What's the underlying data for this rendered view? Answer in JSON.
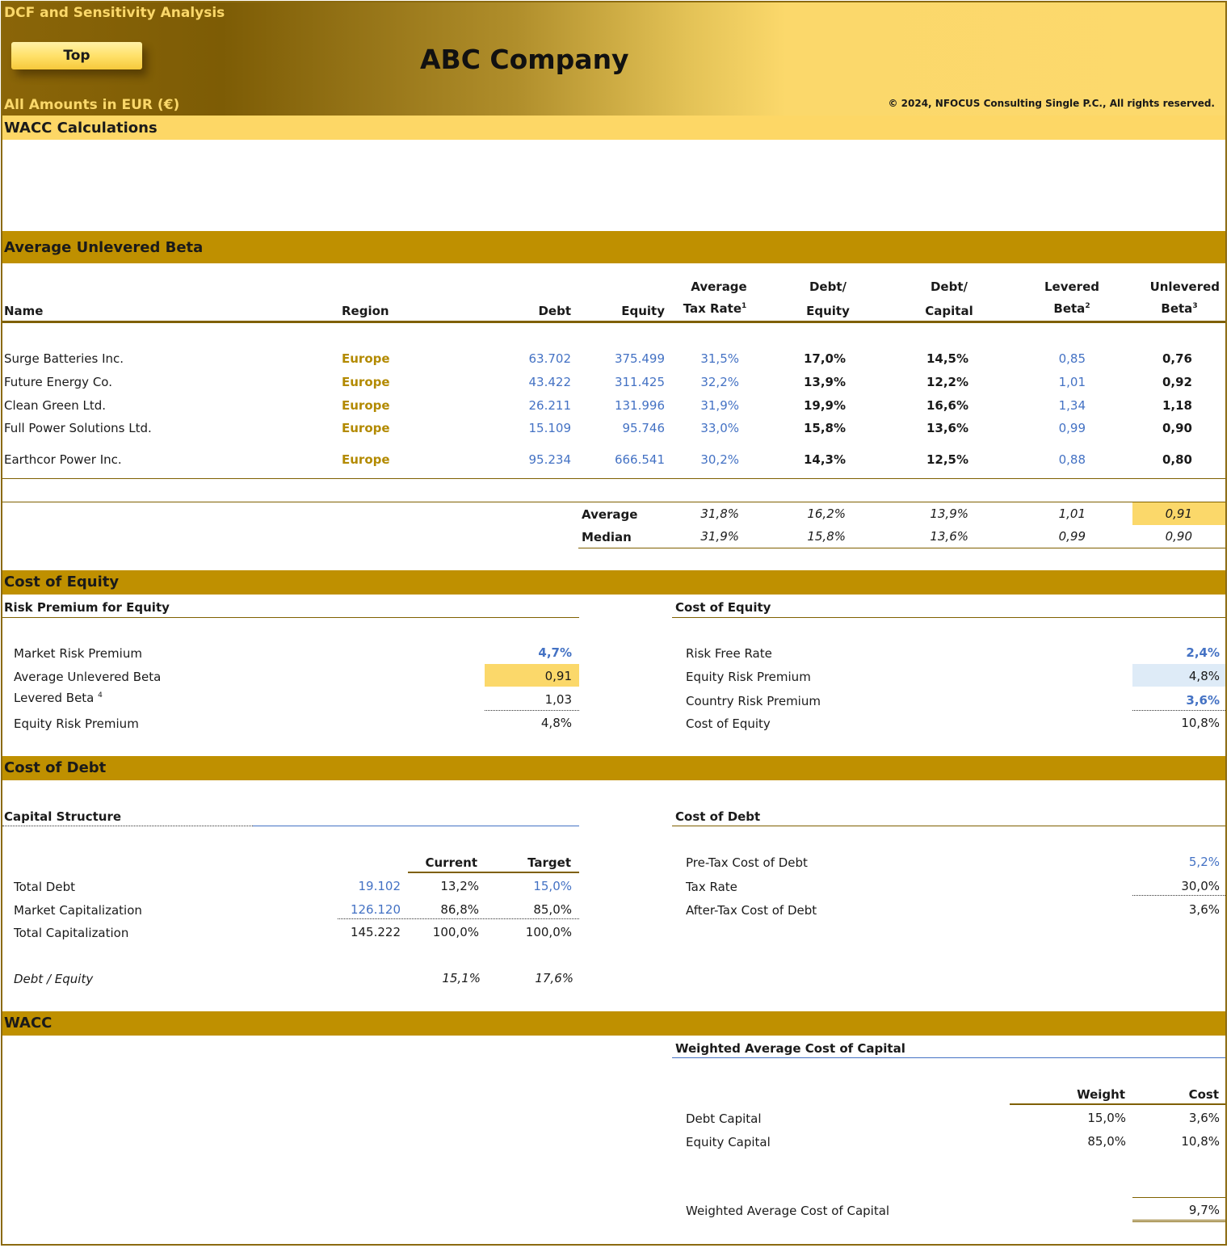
{
  "header": {
    "subtitle": "DCF and Sensitivity Analysis",
    "top_button": "Top",
    "company": "ABC Company",
    "currency_note": "All Amounts in  EUR (€)",
    "copyright": "© 2024, NFOCUS Consulting Single P.C., All rights reserved."
  },
  "wacc_calc": {
    "title": "WACC Calculations"
  },
  "unlevered": {
    "title": "Average Unlevered Beta",
    "headers": {
      "name": "Name",
      "region": "Region",
      "debt": "Debt",
      "equity": "Equity",
      "tax_1": "Average",
      "tax_2": "Tax Rate",
      "tax_sup": "1",
      "de_1": "Debt/",
      "de_2": "Equity",
      "dc_1": "Debt/",
      "dc_2": "Capital",
      "lb_1": "Levered",
      "lb_2": "Beta",
      "lb_sup": "2",
      "ub_1": "Unlevered",
      "ub_2": "Beta",
      "ub_sup": "3"
    },
    "rows": [
      {
        "name": "Surge Batteries Inc.",
        "region": "Europe",
        "debt": "63.702",
        "equity": "375.499",
        "tax": "31,5%",
        "de": "17,0%",
        "dc": "14,5%",
        "lb": "0,85",
        "ub": "0,76"
      },
      {
        "name": "Future Energy Co.",
        "region": "Europe",
        "debt": "43.422",
        "equity": "311.425",
        "tax": "32,2%",
        "de": "13,9%",
        "dc": "12,2%",
        "lb": "1,01",
        "ub": "0,92"
      },
      {
        "name": "Clean Green Ltd.",
        "region": "Europe",
        "debt": "26.211",
        "equity": "131.996",
        "tax": "31,9%",
        "de": "19,9%",
        "dc": "16,6%",
        "lb": "1,34",
        "ub": "1,18"
      },
      {
        "name": "Full Power Solutions Ltd.",
        "region": "Europe",
        "debt": "15.109",
        "equity": "95.746",
        "tax": "33,0%",
        "de": "15,8%",
        "dc": "13,6%",
        "lb": "0,99",
        "ub": "0,90"
      },
      {
        "name": "Earthcor Power Inc.",
        "region": "Europe",
        "debt": "95.234",
        "equity": "666.541",
        "tax": "30,2%",
        "de": "14,3%",
        "dc": "12,5%",
        "lb": "0,88",
        "ub": "0,80"
      }
    ],
    "average": {
      "label": "Average",
      "tax": "31,8%",
      "de": "16,2%",
      "dc": "13,9%",
      "lb": "1,01",
      "ub": "0,91"
    },
    "median": {
      "label": "Median",
      "tax": "31,9%",
      "de": "15,8%",
      "dc": "13,6%",
      "lb": "0,99",
      "ub": "0,90"
    }
  },
  "cost_of_equity": {
    "title": "Cost of Equity",
    "risk_premium": {
      "title": "Risk Premium for Equity",
      "market_risk_premium_label": "Market Risk Premium",
      "market_risk_premium": "4,7%",
      "avg_unlevered_beta_label": "Average Unlevered Beta",
      "avg_unlevered_beta": "0,91",
      "levered_beta_label": "Levered Beta",
      "levered_beta_sup": "4",
      "levered_beta": "1,03",
      "equity_risk_premium_label": "Equity Risk Premium",
      "equity_risk_premium": "4,8%"
    },
    "coe": {
      "title": "Cost of Equity",
      "risk_free_label": "Risk Free Rate",
      "risk_free": "2,4%",
      "erp_label": "Equity Risk Premium",
      "erp": "4,8%",
      "crp_label": "Country Risk Premium",
      "crp": "3,6%",
      "coe_label": "Cost of Equity",
      "coe": "10,8%"
    }
  },
  "cost_of_debt": {
    "title": "Cost of Debt",
    "capital_structure": {
      "title": "Capital Structure",
      "col_current": "Current",
      "col_target": "Target",
      "total_debt_label": "Total Debt",
      "total_debt": "19.102",
      "total_debt_current": "13,2%",
      "total_debt_target": "15,0%",
      "market_cap_label": "Market Capitalization",
      "market_cap": "126.120",
      "market_cap_current": "86,8%",
      "market_cap_target": "85,0%",
      "total_cap_label": "Total Capitalization",
      "total_cap": "145.222",
      "total_cap_current": "100,0%",
      "total_cap_target": "100,0%",
      "de_label": "Debt / Equity",
      "de_current": "15,1%",
      "de_target": "17,6%"
    },
    "cod": {
      "title": "Cost of Debt",
      "pretax_label": "Pre-Tax Cost of Debt",
      "pretax": "5,2%",
      "tax_label": "Tax Rate",
      "tax": "30,0%",
      "aftertax_label": "After-Tax Cost of Debt",
      "aftertax": "3,6%"
    }
  },
  "wacc": {
    "title": "WACC",
    "subtitle": "Weighted Average Cost of Capital",
    "col_weight": "Weight",
    "col_cost": "Cost",
    "debt_label": "Debt Capital",
    "debt_weight": "15,0%",
    "debt_cost": "3,6%",
    "equity_label": "Equity Capital",
    "equity_weight": "85,0%",
    "equity_cost": "10,8%",
    "total_label": "Weighted Average Cost of Capital",
    "total": "9,7%"
  },
  "colors": {
    "gold_bar": "#bf9000",
    "blue_input": "#4472c4",
    "olive_text": "#b38a00",
    "highlight_yellow": "#fbd86a",
    "highlight_blue": "#deebf7"
  }
}
